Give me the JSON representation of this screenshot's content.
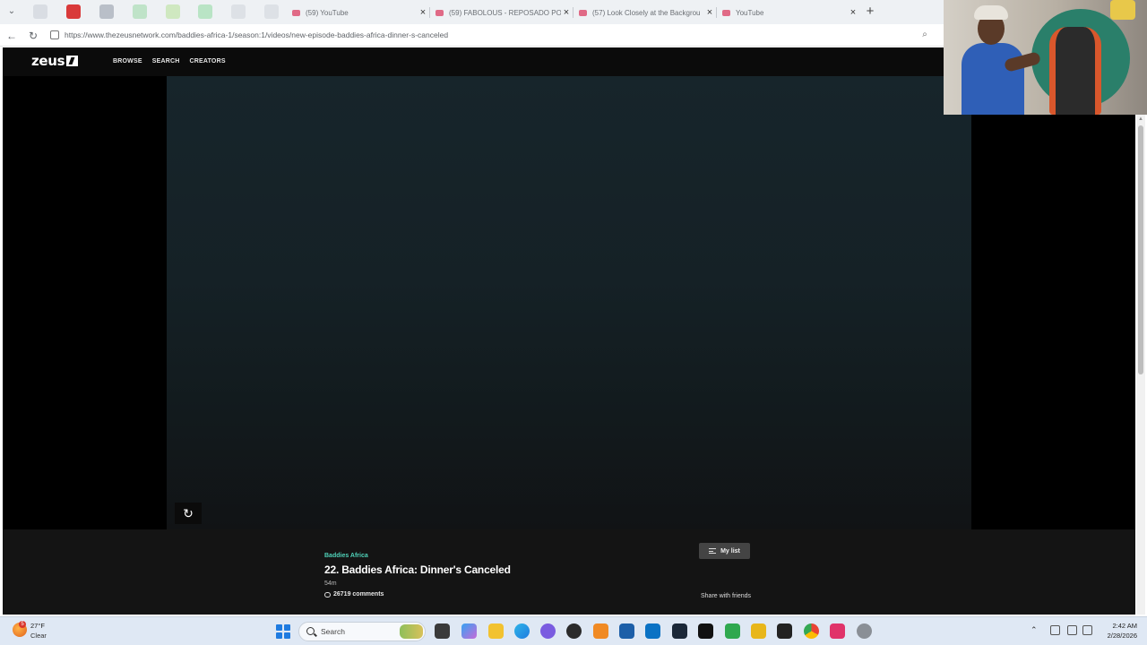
{
  "browser": {
    "tabs": [
      {
        "title": "(59) YouTube"
      },
      {
        "title": "(59) FABOLOUS - REPOSADO POR"
      },
      {
        "title": "(57) Look Closely at the Backgrou"
      },
      {
        "title": "YouTube"
      }
    ],
    "url": "https://www.thezeusnetwork.com/baddies-africa-1/season:1/videos/new-episode-baddies-africa-dinner-s-canceled"
  },
  "site": {
    "logo": "zeus",
    "nav": [
      {
        "label": "BROWSE"
      },
      {
        "label": "SEARCH"
      },
      {
        "label": "CREATORS"
      }
    ],
    "episode": {
      "show": "Baddies Africa",
      "title": "22. Baddies Africa: Dinner's Canceled",
      "duration": "54m",
      "comments": "26719 comments",
      "mylist_label": "My list",
      "share_label": "Share with friends"
    }
  },
  "taskbar": {
    "weather_temp": "27°F",
    "weather_cond": "Clear",
    "weather_badge": "5",
    "search_placeholder": "Search",
    "time": "2:42 AM",
    "date": "2/28/2026"
  },
  "colors": {
    "accent_teal": "#4fd1b8",
    "youtube_tab": "#e06a86"
  }
}
